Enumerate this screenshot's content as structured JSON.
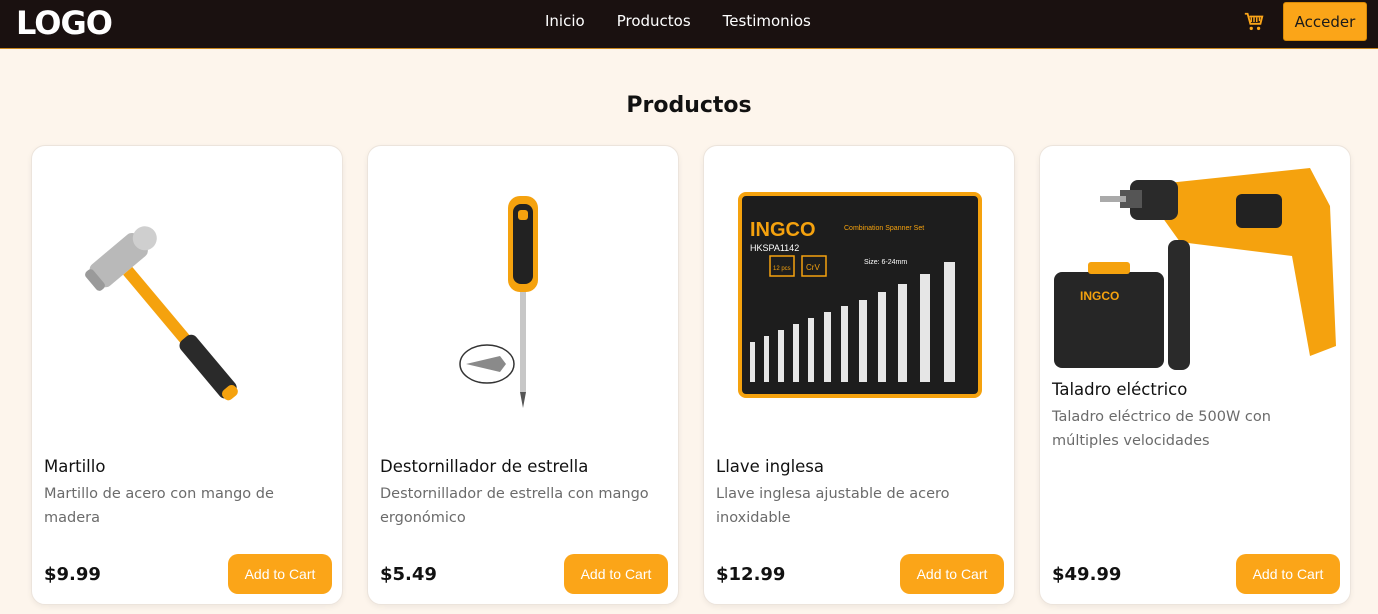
{
  "header": {
    "logo": "LOGO",
    "nav": [
      {
        "label": "Inicio"
      },
      {
        "label": "Productos"
      },
      {
        "label": "Testimonios"
      }
    ],
    "cart_icon": "shopping-cart-icon",
    "login_label": "Acceder"
  },
  "colors": {
    "accent": "#fba518",
    "topbar": "#1a1110",
    "background": "#fdf5ec"
  },
  "section": {
    "title": "Productos"
  },
  "products": [
    {
      "name": "Martillo",
      "description": "Martillo de acero con mango de madera",
      "price": "$9.99",
      "button": "Add to Cart",
      "image": "hammer"
    },
    {
      "name": "Destornillador de estrella",
      "description": "Destornillador de estrella con mango ergonómico",
      "price": "$5.49",
      "button": "Add to Cart",
      "image": "screwdriver"
    },
    {
      "name": "Llave inglesa",
      "description": "Llave inglesa ajustable de acero inoxidable",
      "price": "$12.99",
      "button": "Add to Cart",
      "image": "spanner-set",
      "image_text": {
        "brand": "INGCO",
        "model": "HKSPA1142",
        "kit": "Combination Spanner Set",
        "size": "Size: 6-24mm",
        "count": "12 pcs",
        "material": "CrV"
      }
    },
    {
      "name": "Taladro eléctrico",
      "description": "Taladro eléctrico de 500W con múltiples velocidades",
      "price": "$49.99",
      "button": "Add to Cart",
      "image": "rotary-hammer-drill",
      "image_text": {
        "brand": "INGCO"
      }
    }
  ]
}
